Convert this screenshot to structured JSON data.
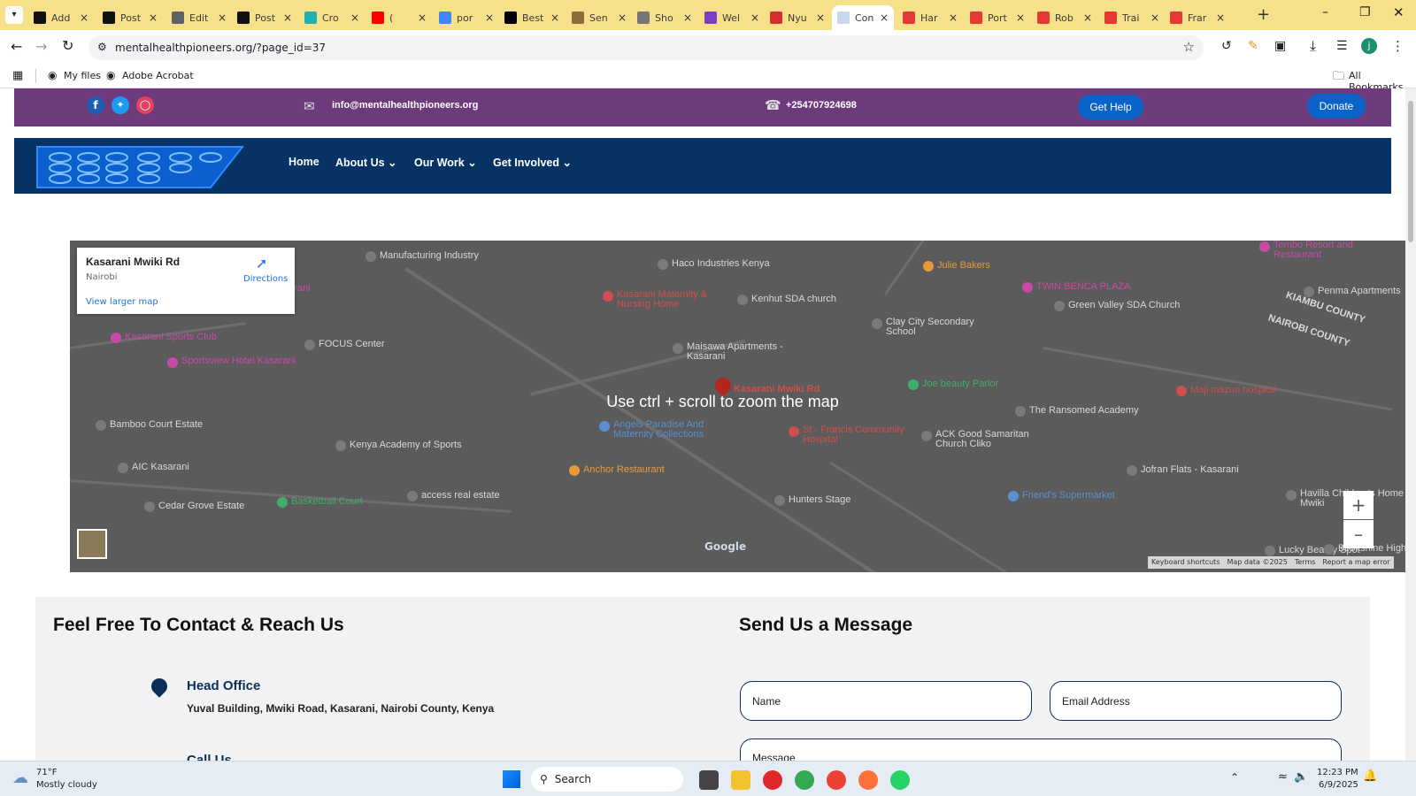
{
  "browser": {
    "tabs": [
      {
        "label": "Add",
        "color": "#111111"
      },
      {
        "label": "Post",
        "color": "#111111"
      },
      {
        "label": "Edit",
        "color": "#5f6368"
      },
      {
        "label": "Post",
        "color": "#111111"
      },
      {
        "label": "Cro",
        "color": "#20b2aa"
      },
      {
        "label": "(",
        "color": "#ff0000"
      },
      {
        "label": "por",
        "color": "#4285f4"
      },
      {
        "label": "Best",
        "color": "#000000"
      },
      {
        "label": "Sen",
        "color": "#8a6d3b"
      },
      {
        "label": "Sho",
        "color": "#777777"
      },
      {
        "label": "Wel",
        "color": "#7b3fbf"
      },
      {
        "label": "Nyu",
        "color": "#d32f2f"
      },
      {
        "label": "Con",
        "color": "#c9d8ea"
      },
      {
        "label": "Har",
        "color": "#e53935"
      },
      {
        "label": "Port",
        "color": "#e53935"
      },
      {
        "label": "Rob",
        "color": "#e53935"
      },
      {
        "label": "Trai",
        "color": "#e53935"
      },
      {
        "label": "Frar",
        "color": "#e53935"
      }
    ],
    "url": "mentalhealthpioneers.org/?page_id=37",
    "bookmarks": {
      "my_files": "My files",
      "adobe": "Adobe Acrobat",
      "all": "All Bookmarks"
    },
    "profile_initial": "j"
  },
  "topbar": {
    "email": "info@mentalhealthpioneers.org",
    "phone": "+254707924698",
    "get_help": "Get Help",
    "donate": "Donate",
    "social_icons": [
      "facebook-icon",
      "twitter-icon",
      "instagram-icon"
    ],
    "bg_color": "#6d3b7c",
    "button_color": "#0a63c9"
  },
  "nav": {
    "items": [
      "Home",
      "About Us",
      "Our Work",
      "Get Involved"
    ],
    "bg_color": "#063264"
  },
  "map": {
    "card_title": "Kasarani Mwiki Rd",
    "card_subtitle": "Nairobi",
    "directions": "Directions",
    "view_larger": "View larger map",
    "overlay_text": "Use ctrl + scroll to zoom the map",
    "pin_label": "Kasarani Mwiki Rd",
    "footer": [
      "Keyboard shortcuts",
      "Map data ©2025",
      "Terms",
      "Report a map error"
    ],
    "google": "Google",
    "labels": [
      {
        "t": "Manufacturing Industry",
        "c": "#d9d9d9"
      },
      {
        "t": "Haco Industries Kenya",
        "c": "#d9d9d9"
      },
      {
        "t": "Julie Bakers",
        "c": "#e69a3a"
      },
      {
        "t": "TWIN BENCA PLAZA",
        "c": "#c94aa6"
      },
      {
        "t": "Penma Apartments",
        "c": "#d9d9d9"
      },
      {
        "t": "partment - Kasarani",
        "c": "#c94aa6"
      },
      {
        "t": "Kasarani Maternity & Nursing Home",
        "c": "#d24d4d"
      },
      {
        "t": "Kenhut SDA church",
        "c": "#d9d9d9"
      },
      {
        "t": "Green Valley SDA Church",
        "c": "#d9d9d9"
      },
      {
        "t": "KIAMBU COUNTY",
        "c": "#d9d9d9"
      },
      {
        "t": "NAIROBI COUNTY",
        "c": "#d9d9d9"
      },
      {
        "t": "Kasarani Sports Club",
        "c": "#c94aa6"
      },
      {
        "t": "FOCUS Center",
        "c": "#d9d9d9"
      },
      {
        "t": "Clay City Secondary School",
        "c": "#d9d9d9"
      },
      {
        "t": "Maisawa Apartments - Kasarani",
        "c": "#d9d9d9"
      },
      {
        "t": "Sportsview Hotel Kasarani",
        "c": "#c94aa6"
      },
      {
        "t": "Joe beauty Parlor",
        "c": "#3fae6a"
      },
      {
        "t": "Maji mazuri hospital",
        "c": "#d24d4d"
      },
      {
        "t": "The Ransomed Academy",
        "c": "#d9d9d9"
      },
      {
        "t": "Angels Paradise And Maternity Collections",
        "c": "#5b8fd1"
      },
      {
        "t": "St - Francis Community Hospital",
        "c": "#d24d4d"
      },
      {
        "t": "Bamboo Court Estate",
        "c": "#d9d9d9"
      },
      {
        "t": "Kenya Academy of Sports",
        "c": "#d9d9d9"
      },
      {
        "t": "ACK Good Samaritan Church Cliko",
        "c": "#d9d9d9"
      },
      {
        "t": "AIC Kasarani",
        "c": "#d9d9d9"
      },
      {
        "t": "Anchor Restaurant",
        "c": "#e69a3a"
      },
      {
        "t": "Jofran Flats - Kasarani",
        "c": "#d9d9d9"
      },
      {
        "t": "Basketball Court",
        "c": "#3fae6a"
      },
      {
        "t": "access real estate",
        "c": "#d9d9d9"
      },
      {
        "t": "Hunters Stage",
        "c": "#d9d9d9"
      },
      {
        "t": "Friend's Supermarket",
        "c": "#5b8fd1"
      },
      {
        "t": "Havilla Children's Home - Mwiki",
        "c": "#d9d9d9"
      },
      {
        "t": "Cedar Grove Estate",
        "c": "#d9d9d9"
      },
      {
        "t": "Lucky Beauty Spot",
        "c": "#d9d9d9"
      },
      {
        "t": "Bookshine High School",
        "c": "#d9d9d9"
      },
      {
        "t": "Tembo Resort and Restaurant",
        "c": "#c94aa6"
      }
    ]
  },
  "contact": {
    "heading_left": "Feel Free To Contact & Reach Us",
    "heading_right": "Send Us a Message",
    "office_title": "Head Office",
    "office_address": "Yuval Building, Mwiki Road, Kasarani, Nairobi County, Kenya",
    "call_title": "Call Us",
    "name_placeholder": "Name",
    "email_placeholder": "Email Address",
    "message_placeholder": "Message"
  },
  "taskbar": {
    "weather_temp": "71°F",
    "weather_desc": "Mostly cloudy",
    "search": "Search",
    "time": "12:23 PM",
    "date": "6/9/2025"
  }
}
